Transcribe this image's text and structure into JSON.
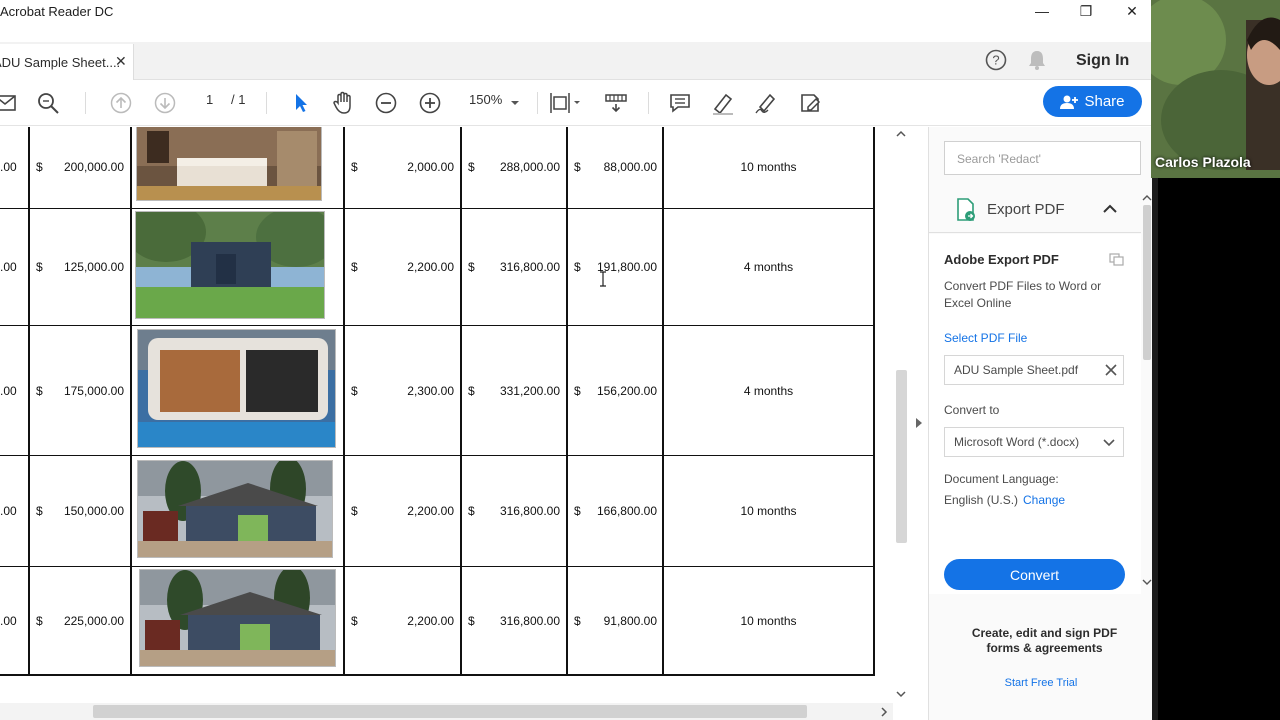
{
  "window": {
    "title": "Acrobat Reader DC",
    "minimize_glyph": "—",
    "restore_glyph": "❐",
    "close_glyph": "✕"
  },
  "tab": {
    "label": "ADU Sample Sheet....",
    "close_glyph": "✕"
  },
  "header": {
    "sign_in": "Sign In",
    "help_icon": "help-circle-icon",
    "bell_icon": "bell-icon"
  },
  "toolbar": {
    "page_current": "1",
    "page_total": "/ 1",
    "zoom": "150%",
    "share_label": "Share"
  },
  "table": {
    "rows": [
      {
        "col0": ".00",
        "cost": "200,000.00",
        "sqft_price": "2,000.00",
        "value": "288,000.00",
        "equity": "88,000.00",
        "time": "10 months"
      },
      {
        "col0": ".00",
        "cost": "125,000.00",
        "sqft_price": "2,200.00",
        "value": "316,800.00",
        "equity": "191,800.00",
        "time": "4 months"
      },
      {
        "col0": ".00",
        "cost": "175,000.00",
        "sqft_price": "2,300.00",
        "value": "331,200.00",
        "equity": "156,200.00",
        "time": "4 months"
      },
      {
        "col0": ".00",
        "cost": "150,000.00",
        "sqft_price": "2,200.00",
        "value": "316,800.00",
        "equity": "166,800.00",
        "time": "10 months"
      },
      {
        "col0": ".00",
        "cost": "225,000.00",
        "sqft_price": "2,200.00",
        "value": "316,800.00",
        "equity": "91,800.00",
        "time": "10 months"
      }
    ],
    "currency": "$"
  },
  "panel": {
    "search_placeholder": "Search 'Redact'",
    "export_title": "Export PDF",
    "card_title": "Adobe Export PDF",
    "card_desc": "Convert PDF Files to Word or Excel Online",
    "select_file": "Select PDF File",
    "file_name": "ADU Sample Sheet.pdf",
    "convert_to_label": "Convert to",
    "convert_to_value": "Microsoft Word (*.docx)",
    "doc_lang_label": "Document Language:",
    "doc_lang_value": "English (U.S.)",
    "change_link": "Change",
    "convert_button": "Convert",
    "promo_text": "Create, edit and sign PDF forms & agreements",
    "trial_link": "Start Free Trial"
  },
  "webcam": {
    "name": "Carlos Plazola"
  },
  "colors": {
    "accent": "#1473e6",
    "link": "#1473e6"
  }
}
